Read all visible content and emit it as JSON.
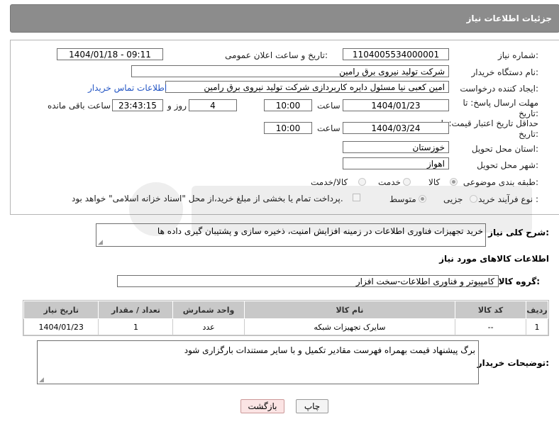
{
  "title": "جزئیات اطلاعات نیاز",
  "fields": {
    "need_number_label": "شماره نیاز:",
    "need_number": "1104005534000001",
    "announce_label": "تاریخ و ساعت اعلان عمومی:",
    "announce_value": "1404/01/18 - 09:11",
    "buyer_org_label": "نام دستگاه خریدار:",
    "buyer_org": "شرکت تولید نیروی برق رامین",
    "creator_label": "ایجاد کننده درخواست:",
    "creator": "امین کعبی نیا مسئول دایره کاربردازی شرکت تولید نیروی برق رامین",
    "contact_link": "اطلاعات تماس خریدار",
    "deadline_label": "مهلت ارسال پاسخ: تا تاریخ:",
    "deadline_date": "1404/01/23",
    "time_word": "ساعت",
    "deadline_time": "10:00",
    "days_value": "4",
    "days_word": "روز و",
    "remaining_time": "23:43:15",
    "remaining_word": "ساعت باقی مانده",
    "validity_label": "حداقل تاریخ اعتبار قیمت: تا تاریخ:",
    "validity_date": "1404/03/24",
    "validity_time": "10:00",
    "province_label": "استان محل تحویل:",
    "province": "خوزستان",
    "city_label": "شهر محل تحویل:",
    "city": "اهواز",
    "category_label": "طبقه بندی موضوعی:",
    "category_options": [
      "کالا",
      "خدمت",
      "کالا/خدمت"
    ],
    "process_label": "نوع فرآیند خرید :",
    "process_options": [
      "جزیی",
      "متوسط"
    ],
    "payment_note": "پرداخت تمام یا بخشی از مبلغ خرید،از محل \"اسناد خزانه اسلامی\" خواهد بود."
  },
  "description": {
    "label": "شرح کلی نیاز:",
    "value": "خرید تجهیزات فناوری اطلاعات در زمینه افزایش امنیت، ذخیره سازی و پشتیبان گیری داده ها"
  },
  "goods_section": {
    "title": "اطلاعات کالاهای مورد نیاز",
    "group_label": "گروه کالا:",
    "group_value": "کامپیوتر و فناوری اطلاعات-سخت افزار"
  },
  "table": {
    "headers": [
      "ردیف",
      "کد کالا",
      "نام کالا",
      "واحد شمارش",
      "تعداد / مقدار",
      "تاریخ نیاز"
    ],
    "rows": [
      [
        "1",
        "--",
        "سایرک تجهیزات شبکه",
        "عدد",
        "1",
        "1404/01/23"
      ]
    ]
  },
  "buyer_notes": {
    "label": "توضیحات خریدار:",
    "value": "برگ پیشنهاد قیمت بهمراه فهرست مقادیر تکمیل و با سایر مستندات بارگزاری شود"
  },
  "buttons": {
    "print": "چاپ",
    "back": "بازگشت"
  },
  "colors": {
    "titlebar": "#8c8c8c",
    "link": "#2456c4",
    "back_button_bg": "#fbe4e4"
  }
}
